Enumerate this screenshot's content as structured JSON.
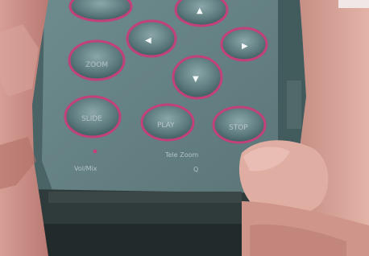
{
  "photo": {
    "subject": "remote-control",
    "colors": {
      "remote_body": "#5e7a7d",
      "remote_panel": "#6f8d90",
      "button_face": "#4c6b6e",
      "button_ring": "#c2417a",
      "skin": "#c98f86",
      "base": "#2d3a3a",
      "background": "#f6f4f2"
    }
  },
  "remote": {
    "labels": {
      "button_left_mid": "ZOOM",
      "button_center_low": "PLAY",
      "button_right_low": "STOP",
      "button_left_low": "SLIDE",
      "panel_left": "Vol/Mix",
      "panel_center": "Tele Zoom",
      "panel_center_sub": "Q"
    }
  }
}
